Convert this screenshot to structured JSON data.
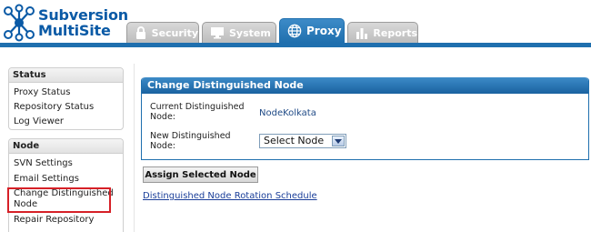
{
  "app": {
    "logo_line1": "Subversion",
    "logo_line2": "MultiSite",
    "brand_color": "#0a5aa6"
  },
  "tabs": [
    {
      "label": "Security",
      "icon": "lock-icon",
      "active": false
    },
    {
      "label": "System",
      "icon": "monitor-icon",
      "active": false
    },
    {
      "label": "Proxy",
      "icon": "globe-icon",
      "active": true
    },
    {
      "label": "Reports",
      "icon": "bar-chart-icon",
      "active": false
    }
  ],
  "sidebar": {
    "status": {
      "heading": "Status",
      "items": [
        "Proxy Status",
        "Repository Status",
        "Log Viewer"
      ]
    },
    "node": {
      "heading": "Node",
      "items": [
        "SVN Settings",
        "Email Settings",
        "Change Distinguished Node",
        "Repair Repository"
      ],
      "selected_index": 2
    }
  },
  "panel": {
    "title": "Change Distinguished Node",
    "current_label": "Current Distinguished Node:",
    "current_value": "NodeKolkata",
    "new_label": "New Distinguished Node:",
    "select_value": "Select Node"
  },
  "assign_button": "Assign Selected Node",
  "rotation_link": "Distinguished Node Rotation Schedule",
  "colors": {
    "accent": "#1f6fae",
    "highlight": "#d62027",
    "link": "#1a3e99"
  }
}
